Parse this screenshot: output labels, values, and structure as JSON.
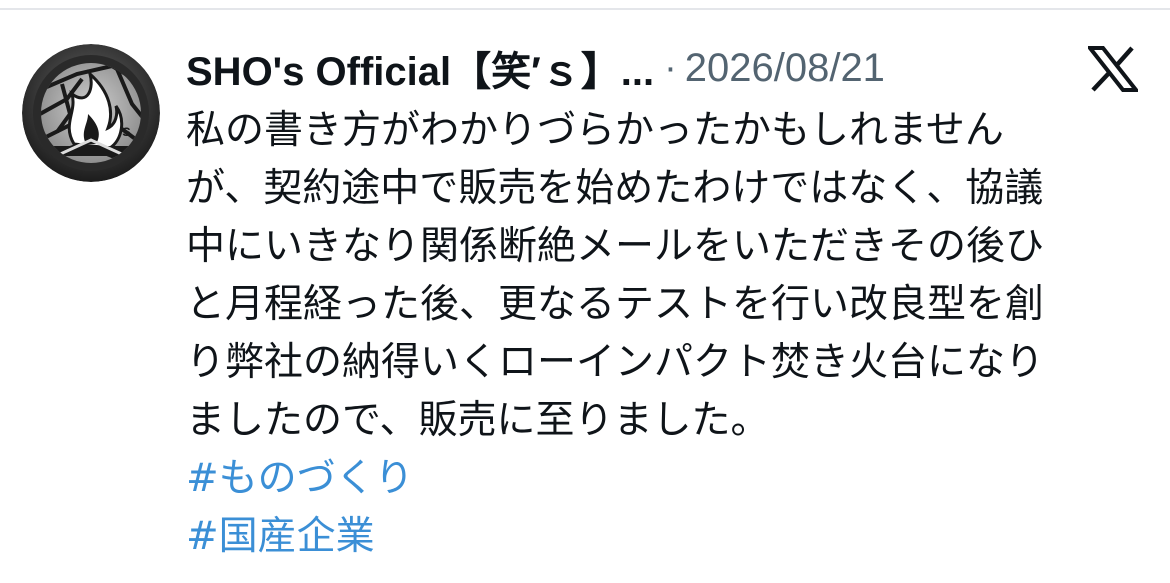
{
  "post": {
    "author": "SHO's Official【笑′ｓ】...",
    "separator": "·",
    "date": "2026/08/21",
    "platform_icon": "x-logo-icon",
    "body_lines": [
      "私の書き方がわかりづらかったかもしれません",
      "が、契約途中で販売を始めたわけではなく、協議",
      "中にいきなり関係断絶メールをいただきその後ひ",
      "と月程経った後、更なるテストを行い改良型を創",
      "り弊社の納得いくローインパクト焚き火台になり",
      "ましたので、販売に至りました。"
    ],
    "hashtags": [
      "#ものづくり",
      "#国産企業"
    ]
  },
  "colors": {
    "text": "#0f1419",
    "secondary": "#536471",
    "hashtag": "#3b8fd6",
    "divider": "#e4e6ea"
  }
}
